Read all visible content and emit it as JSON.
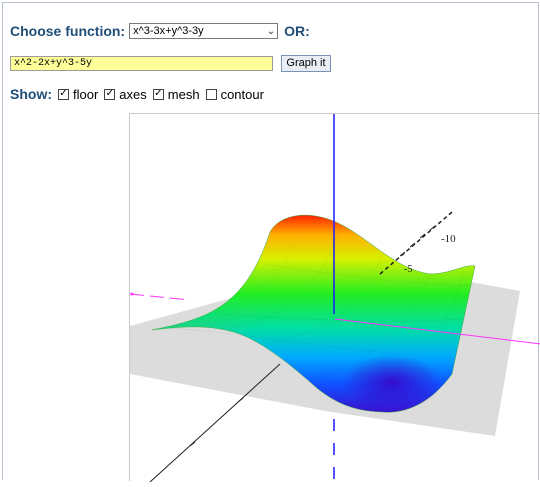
{
  "controls": {
    "choose_label": "Choose function:",
    "selected_function": "x^3-3x+y^3-3y",
    "or_label": "OR:",
    "function_input_value": "x^2-2x+y^3-5y",
    "graph_button_label": "Graph it"
  },
  "show": {
    "label": "Show:",
    "options": [
      {
        "label": "floor",
        "checked": true
      },
      {
        "label": "axes",
        "checked": true
      },
      {
        "label": "mesh",
        "checked": true
      },
      {
        "label": "contour",
        "checked": false
      }
    ]
  },
  "plot": {
    "tick_labels": [
      "-10",
      "-5"
    ],
    "colors": {
      "floor": "#dcdcdc",
      "z_axis": "#1a1aff",
      "x_axis": "#ff33ff",
      "y_axis": "#222222"
    }
  }
}
